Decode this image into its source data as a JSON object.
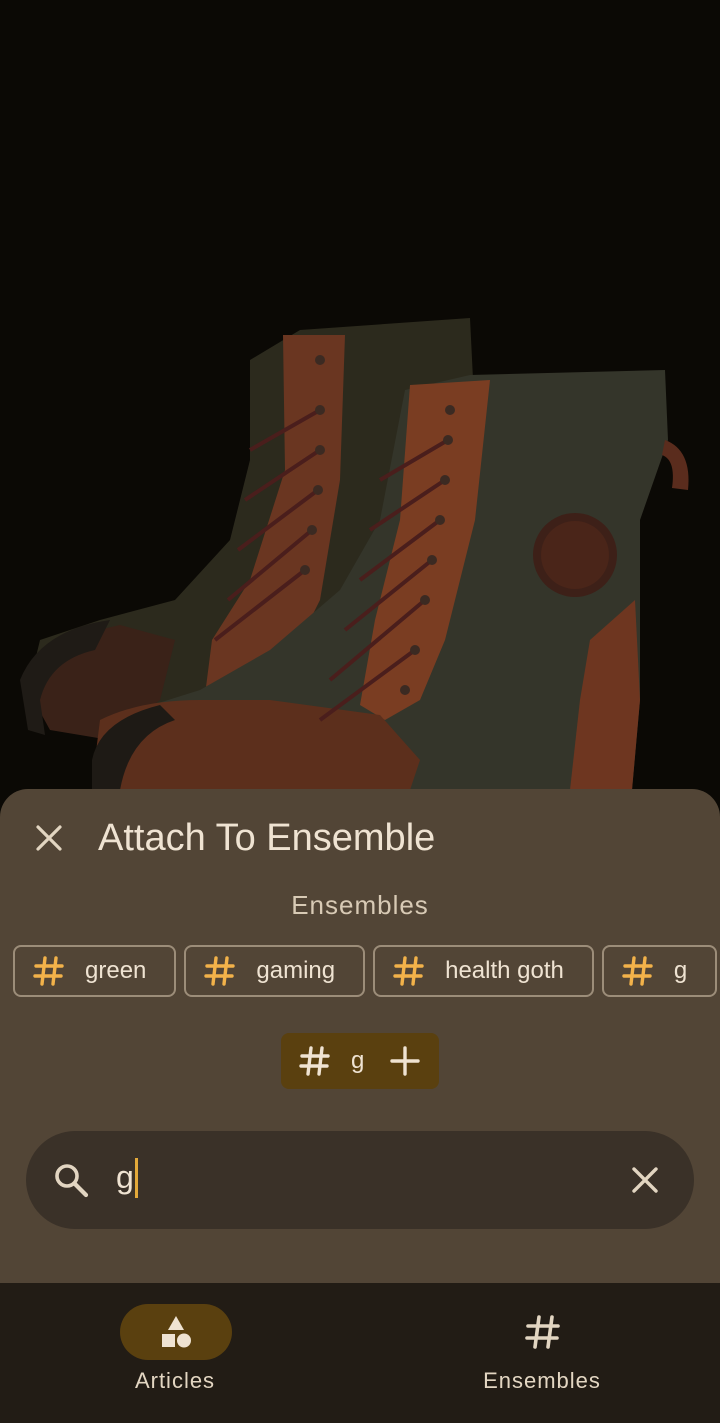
{
  "photo": {
    "subject": "brown leather and olive canvas lace-up boots"
  },
  "sheet": {
    "title": "Attach To Ensemble",
    "section_label": "Ensembles",
    "chips": [
      {
        "label": "green"
      },
      {
        "label": "gaming"
      },
      {
        "label": "health goth"
      },
      {
        "label": "g"
      }
    ],
    "new_tag": {
      "label": "g"
    },
    "search": {
      "value": "g"
    }
  },
  "nav": {
    "items": [
      {
        "label": "Articles",
        "selected": true
      },
      {
        "label": "Ensembles",
        "selected": false
      }
    ]
  },
  "colors": {
    "accent": "#f2b24a",
    "sheet": "#524536",
    "nav_bg": "#221c15",
    "selected_pill": "#5a400f"
  }
}
